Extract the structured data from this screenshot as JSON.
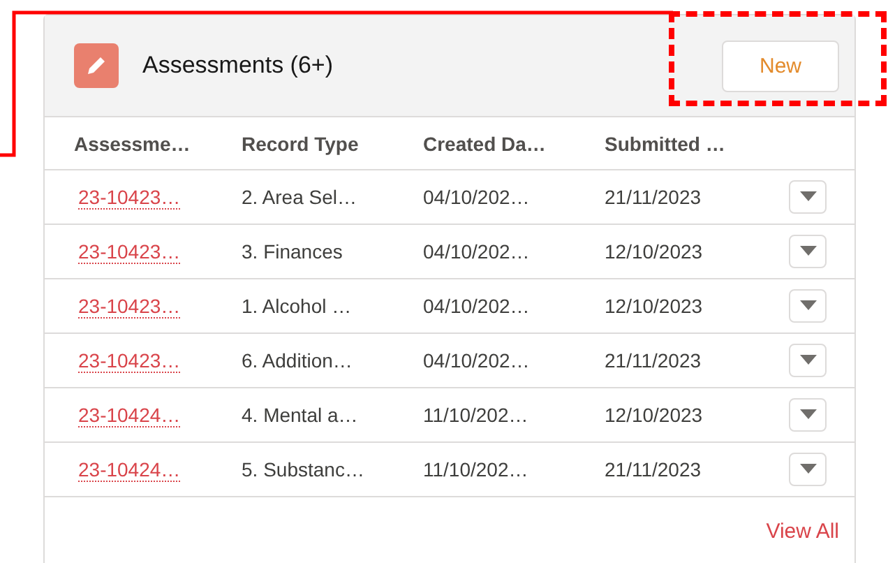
{
  "card": {
    "title": "Assessments (6+)",
    "new_button": "New",
    "highlighted": true
  },
  "table": {
    "columns": [
      "Assessme…",
      "Record Type",
      "Created Da…",
      "Submitted …"
    ],
    "rows": [
      {
        "cells": [
          "23-10423…",
          "2. Area Sel…",
          "04/10/202…",
          "21/11/2023"
        ]
      },
      {
        "cells": [
          "23-10423…",
          "3. Finances",
          "04/10/202…",
          "12/10/2023"
        ]
      },
      {
        "cells": [
          "23-10423…",
          "1. Alcohol …",
          "04/10/202…",
          "12/10/2023"
        ]
      },
      {
        "cells": [
          "23-10423…",
          "6. Addition…",
          "04/10/202…",
          "21/11/2023"
        ]
      },
      {
        "cells": [
          "23-10424…",
          "4. Mental a…",
          "11/10/202…",
          "12/10/2023"
        ]
      },
      {
        "cells": [
          "23-10424…",
          "5. Substanc…",
          "11/10/202…",
          "21/11/2023"
        ]
      }
    ]
  },
  "footer": {
    "link": "View All"
  }
}
